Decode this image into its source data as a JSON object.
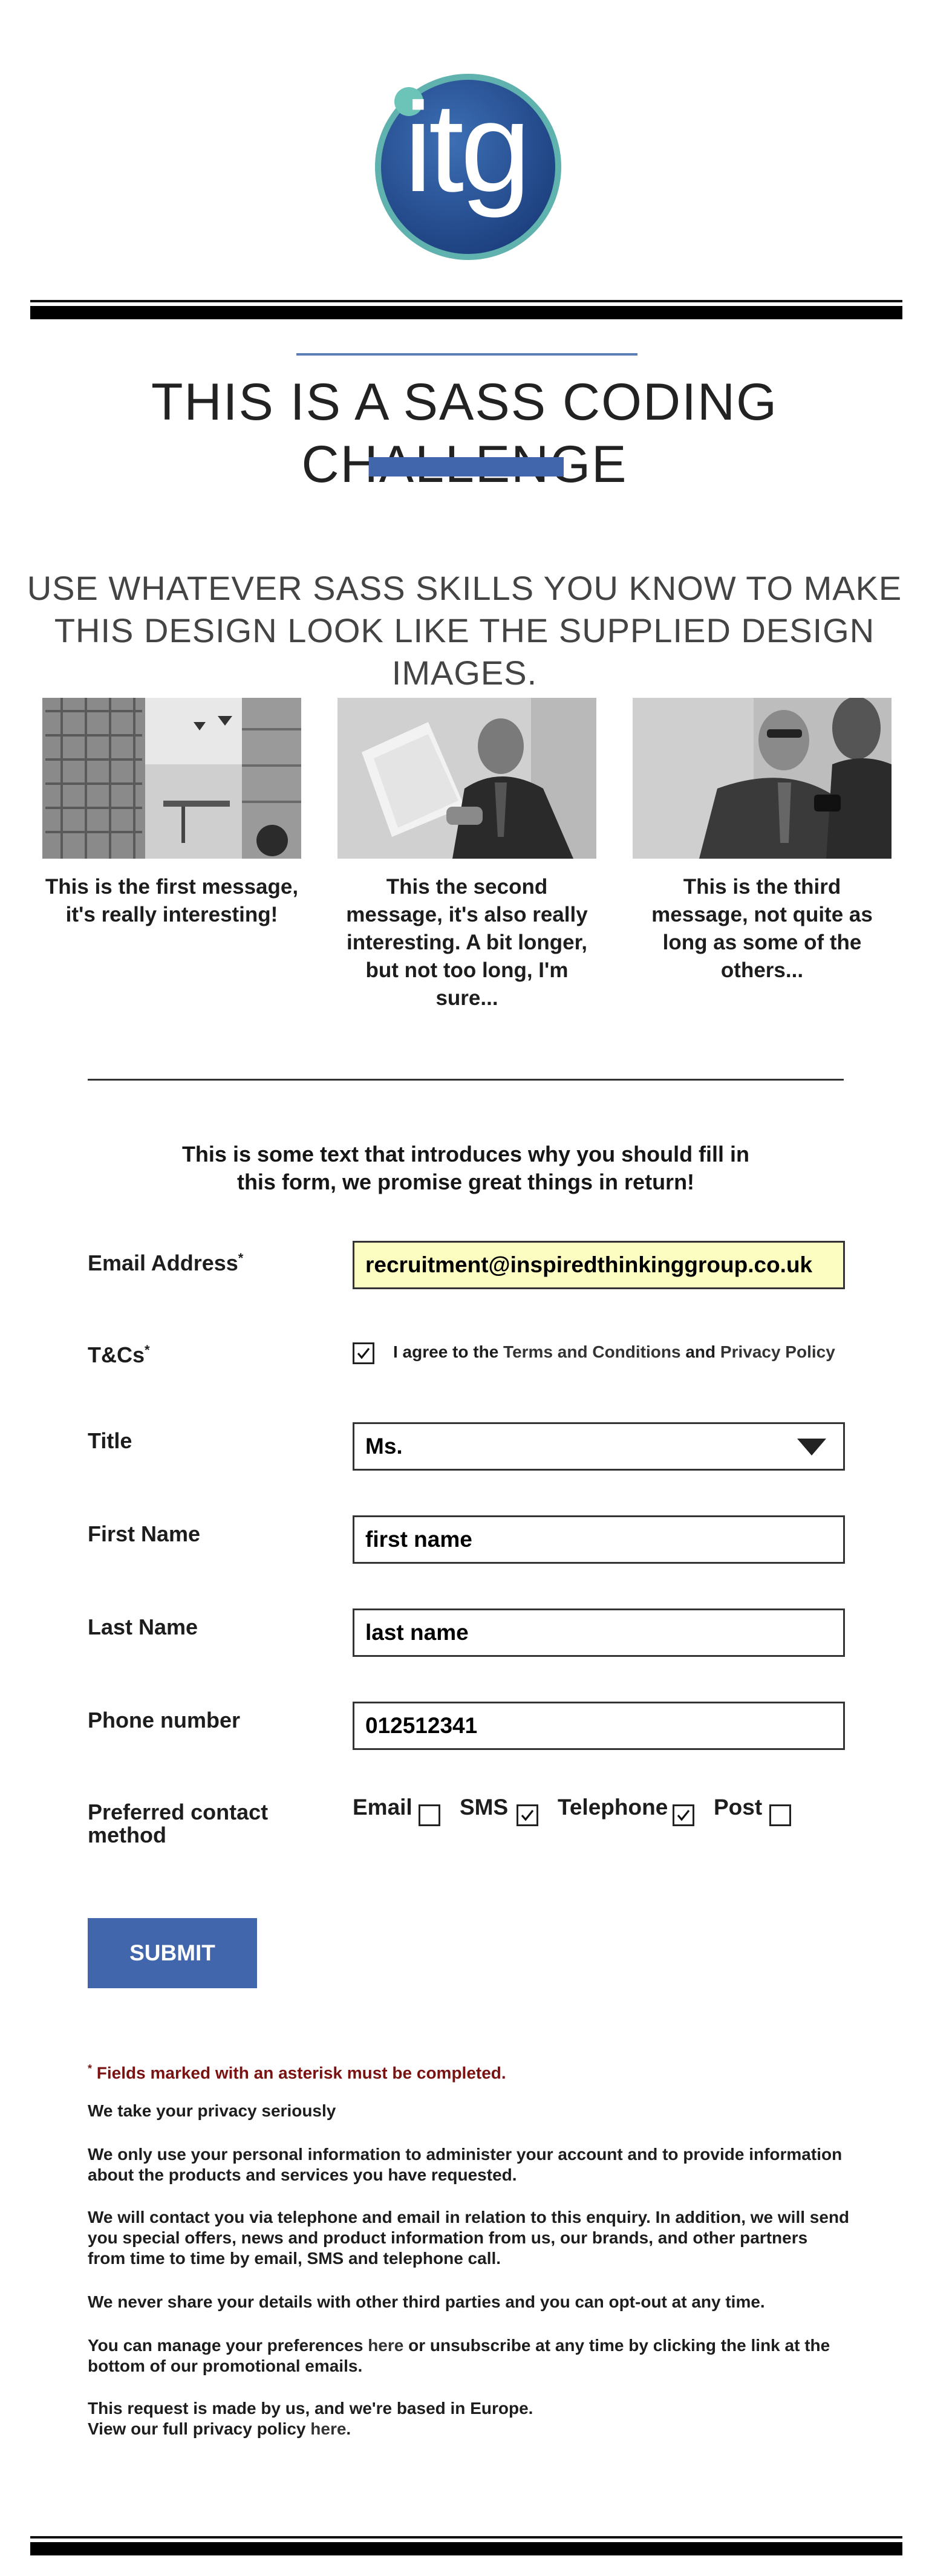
{
  "header": {
    "logo_text": "itg",
    "logo_colors": {
      "outer_ring": "#5fb2ad",
      "inner": "#234f93",
      "dot": "#6cc3b8"
    }
  },
  "hero": {
    "title": "THIS IS A SASS CODING CHALLENGE",
    "subtitle": "USE WHATEVER SASS SKILLS YOU KNOW TO MAKE THIS DESIGN LOOK LIKE THE SUPPLIED DESIGN IMAGES.",
    "accent_color": "#4266ac"
  },
  "cards": [
    {
      "image": "library-interior-photo",
      "caption": "This is the first message, it's really interesting!"
    },
    {
      "image": "man-reading-document-photo",
      "caption": "This the second message, it's also really interesting. A bit longer, but not too long, I'm sure..."
    },
    {
      "image": "two-men-with-phone-photo",
      "caption": "This is the third message, not quite as long as some of the others..."
    }
  ],
  "form": {
    "intro": "This is some text that introduces why you should fill in this form, we promise great things in return!",
    "email": {
      "label": "Email Address",
      "required_mark": "*",
      "value": "recruitment@inspiredthinkinggroup.co.uk"
    },
    "tcs": {
      "label": "T&Cs",
      "required_mark": "*",
      "checked": true,
      "text_prefix": "I agree to the ",
      "terms_link": "Terms and Conditions",
      "text_and": " and ",
      "privacy_link": "Privacy Policy"
    },
    "title": {
      "label": "Title",
      "selected": "Ms."
    },
    "first_name": {
      "label": "First Name",
      "value": "first name"
    },
    "last_name": {
      "label": "Last Name",
      "value": "last name"
    },
    "phone": {
      "label": "Phone number",
      "value": "012512341"
    },
    "contact": {
      "label_line1": "Preferred contact",
      "label_line2": "method",
      "options": [
        {
          "label": "Email",
          "checked": false
        },
        {
          "label": "SMS",
          "checked": true
        },
        {
          "label": "Telephone",
          "checked": true
        },
        {
          "label": "Post",
          "checked": false
        }
      ]
    },
    "submit_label": "SUBMIT"
  },
  "footer": {
    "required_note_mark": "*",
    "required_note": " Fields marked with an asterisk must be completed.",
    "privacy_heading": "We take your privacy seriously",
    "p1": "We only use your personal information to administer your account and to provide information about the products and services you have requested.",
    "p2": "We will contact you via telephone and email in relation to this enquiry. In addition, we will send you special offers, news and product information from us, our brands, and other partners from time to time by email, SMS and telephone call.",
    "p3": "We never share your details with other third parties and you can opt-out at any time.",
    "p4_a": "You can manage your preferences ",
    "p4_link": "here",
    "p4_b": " or unsubscribe at any time by clicking the link at the bottom of our promotional emails.",
    "p5_line1": "This request is made by us, and we're based in Europe.",
    "p5_a": "View our full privacy policy ",
    "p5_link": "here",
    "p5_b": "."
  }
}
